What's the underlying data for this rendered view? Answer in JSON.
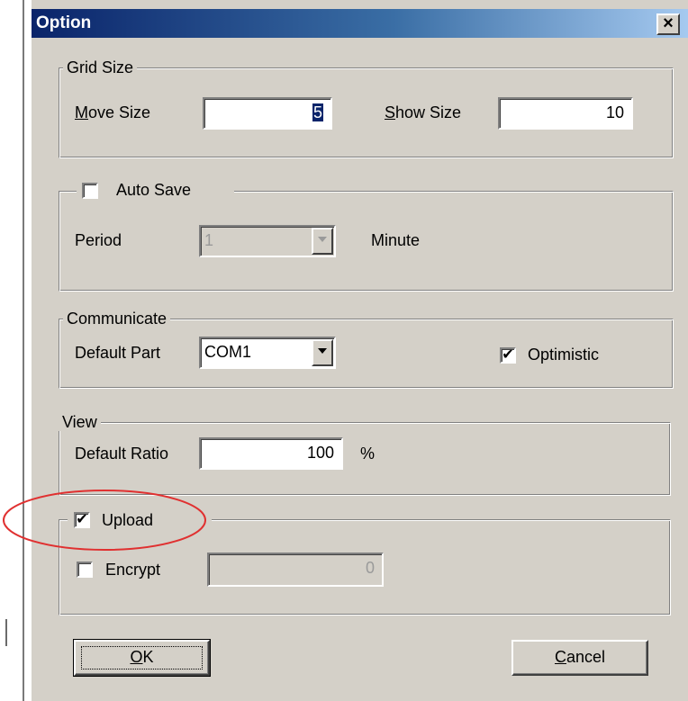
{
  "dialog": {
    "title": "Option",
    "close_glyph": "×"
  },
  "grid_size": {
    "legend": "Grid Size",
    "move_size_label": "Move Size",
    "move_size_value": "5",
    "show_size_label": "Show Size",
    "show_size_value": "10"
  },
  "auto_save": {
    "legend": "Auto Save",
    "checked": false,
    "period_label": "Period",
    "period_value": "1",
    "unit_label": "Minute"
  },
  "communicate": {
    "legend": "Communicate",
    "default_part_label": "Default Part",
    "default_part_value": "COM1",
    "optimistic_label": "Optimistic",
    "optimistic_checked": true
  },
  "view": {
    "legend": "View",
    "default_ratio_label": "Default Ratio",
    "default_ratio_value": "100",
    "unit": "%"
  },
  "upload": {
    "legend": "Upload",
    "checked": true,
    "encrypt_label": "Encrypt",
    "encrypt_checked": false,
    "encrypt_value": "0"
  },
  "buttons": {
    "ok": "OK",
    "cancel": "Cancel"
  },
  "check_glyph": "✔",
  "colors": {
    "dialog_face": "#d4d0c8",
    "title_start": "#0a246a",
    "title_end": "#a6caf0",
    "callout": "#e03030"
  }
}
